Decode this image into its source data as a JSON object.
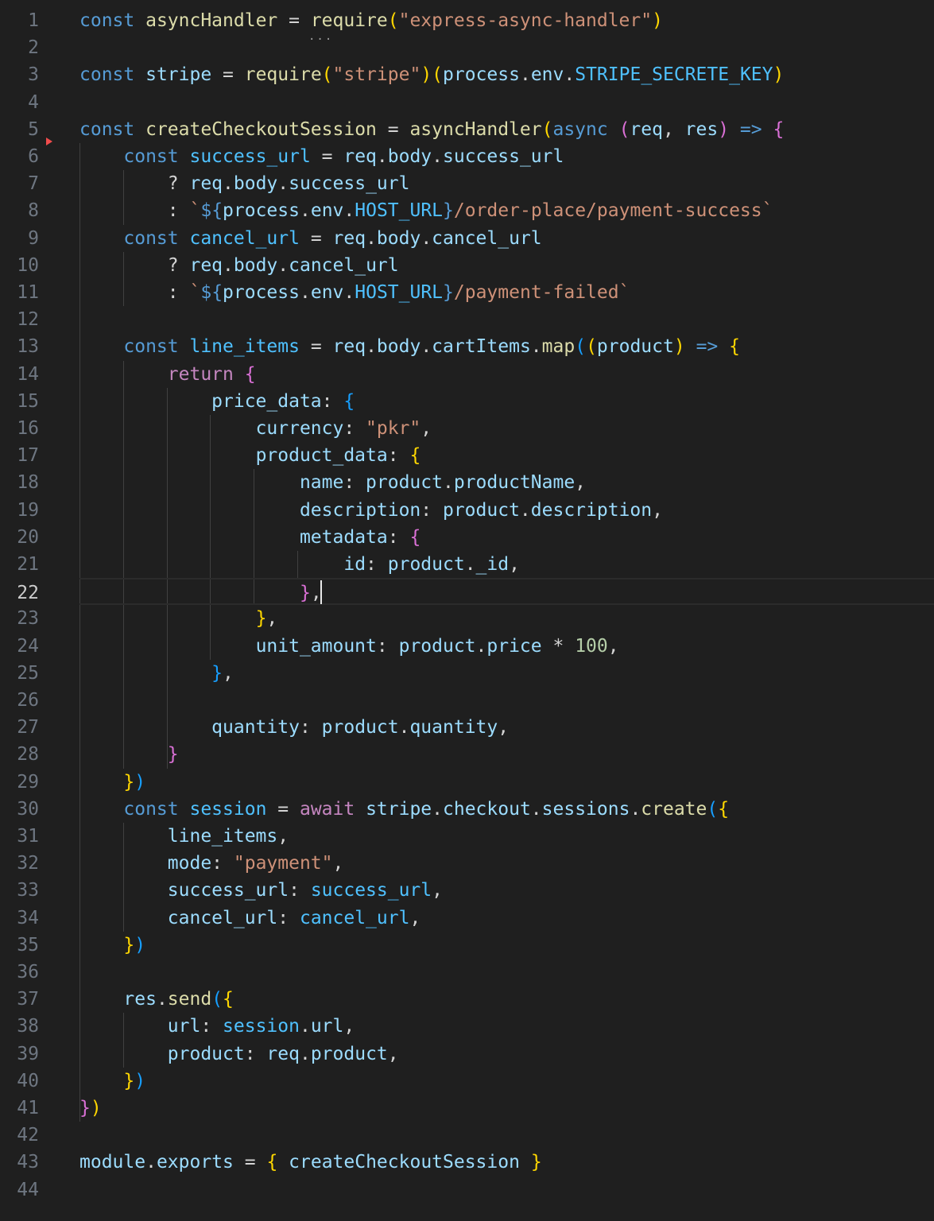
{
  "editor": {
    "active_line": 22,
    "lines": [
      {
        "n": "1",
        "t": [
          [
            "kw",
            "const "
          ],
          [
            "fn",
            "asyncHandler"
          ],
          [
            "op",
            " = "
          ],
          [
            "fn",
            "require"
          ],
          [
            "p1",
            "("
          ],
          [
            "str",
            "\"express-async-handler\""
          ],
          [
            "p1",
            ")"
          ]
        ]
      },
      {
        "n": "2",
        "t": []
      },
      {
        "n": "3",
        "t": [
          [
            "kw",
            "const "
          ],
          [
            "var",
            "stripe"
          ],
          [
            "op",
            " = "
          ],
          [
            "fn",
            "require"
          ],
          [
            "p1",
            "("
          ],
          [
            "str",
            "\"stripe\""
          ],
          [
            "p1",
            ")"
          ],
          [
            "p1",
            "("
          ],
          [
            "var",
            "process"
          ],
          [
            "op",
            "."
          ],
          [
            "var",
            "env"
          ],
          [
            "op",
            "."
          ],
          [
            "cst",
            "STRIPE_SECRETE_KEY"
          ],
          [
            "p1",
            ")"
          ]
        ]
      },
      {
        "n": "4",
        "t": []
      },
      {
        "n": "5",
        "t": [
          [
            "kw",
            "const "
          ],
          [
            "fn",
            "createCheckoutSession"
          ],
          [
            "op",
            " = "
          ],
          [
            "fn",
            "asyncHandler"
          ],
          [
            "p1",
            "("
          ],
          [
            "kw",
            "async "
          ],
          [
            "p2",
            "("
          ],
          [
            "var",
            "req"
          ],
          [
            "op",
            ", "
          ],
          [
            "var",
            "res"
          ],
          [
            "p2",
            ")"
          ],
          [
            "kw",
            " => "
          ],
          [
            "p2",
            "{"
          ]
        ]
      },
      {
        "n": "6",
        "t": [
          [
            "op",
            "    "
          ],
          [
            "kw",
            "const "
          ],
          [
            "cst",
            "success_url"
          ],
          [
            "op",
            " = "
          ],
          [
            "var",
            "req"
          ],
          [
            "op",
            "."
          ],
          [
            "var",
            "body"
          ],
          [
            "op",
            "."
          ],
          [
            "var",
            "success_url"
          ]
        ]
      },
      {
        "n": "7",
        "t": [
          [
            "op",
            "        ? "
          ],
          [
            "var",
            "req"
          ],
          [
            "op",
            "."
          ],
          [
            "var",
            "body"
          ],
          [
            "op",
            "."
          ],
          [
            "var",
            "success_url"
          ]
        ]
      },
      {
        "n": "8",
        "t": [
          [
            "op",
            "        : "
          ],
          [
            "str",
            "`"
          ],
          [
            "kw",
            "${"
          ],
          [
            "var",
            "process"
          ],
          [
            "op",
            "."
          ],
          [
            "var",
            "env"
          ],
          [
            "op",
            "."
          ],
          [
            "cst",
            "HOST_URL"
          ],
          [
            "kw",
            "}"
          ],
          [
            "str",
            "/order-place/payment-success`"
          ]
        ]
      },
      {
        "n": "9",
        "t": [
          [
            "op",
            "    "
          ],
          [
            "kw",
            "const "
          ],
          [
            "cst",
            "cancel_url"
          ],
          [
            "op",
            " = "
          ],
          [
            "var",
            "req"
          ],
          [
            "op",
            "."
          ],
          [
            "var",
            "body"
          ],
          [
            "op",
            "."
          ],
          [
            "var",
            "cancel_url"
          ]
        ]
      },
      {
        "n": "10",
        "t": [
          [
            "op",
            "        ? "
          ],
          [
            "var",
            "req"
          ],
          [
            "op",
            "."
          ],
          [
            "var",
            "body"
          ],
          [
            "op",
            "."
          ],
          [
            "var",
            "cancel_url"
          ]
        ]
      },
      {
        "n": "11",
        "t": [
          [
            "op",
            "        : "
          ],
          [
            "str",
            "`"
          ],
          [
            "kw",
            "${"
          ],
          [
            "var",
            "process"
          ],
          [
            "op",
            "."
          ],
          [
            "var",
            "env"
          ],
          [
            "op",
            "."
          ],
          [
            "cst",
            "HOST_URL"
          ],
          [
            "kw",
            "}"
          ],
          [
            "str",
            "/payment-failed`"
          ]
        ]
      },
      {
        "n": "12",
        "t": []
      },
      {
        "n": "13",
        "t": [
          [
            "op",
            "    "
          ],
          [
            "kw",
            "const "
          ],
          [
            "cst",
            "line_items"
          ],
          [
            "op",
            " = "
          ],
          [
            "var",
            "req"
          ],
          [
            "op",
            "."
          ],
          [
            "var",
            "body"
          ],
          [
            "op",
            "."
          ],
          [
            "var",
            "cartItems"
          ],
          [
            "op",
            "."
          ],
          [
            "fn",
            "map"
          ],
          [
            "p3",
            "("
          ],
          [
            "p1",
            "("
          ],
          [
            "var",
            "product"
          ],
          [
            "p1",
            ")"
          ],
          [
            "kw",
            " => "
          ],
          [
            "p1",
            "{"
          ]
        ]
      },
      {
        "n": "14",
        "t": [
          [
            "op",
            "        "
          ],
          [
            "ctl",
            "return "
          ],
          [
            "p2",
            "{"
          ]
        ]
      },
      {
        "n": "15",
        "t": [
          [
            "op",
            "            "
          ],
          [
            "var",
            "price_data"
          ],
          [
            "op",
            ": "
          ],
          [
            "p3",
            "{"
          ]
        ]
      },
      {
        "n": "16",
        "t": [
          [
            "op",
            "                "
          ],
          [
            "var",
            "currency"
          ],
          [
            "op",
            ": "
          ],
          [
            "str",
            "\"pkr\""
          ],
          [
            "op",
            ","
          ]
        ]
      },
      {
        "n": "17",
        "t": [
          [
            "op",
            "                "
          ],
          [
            "var",
            "product_data"
          ],
          [
            "op",
            ": "
          ],
          [
            "p1",
            "{"
          ]
        ]
      },
      {
        "n": "18",
        "t": [
          [
            "op",
            "                    "
          ],
          [
            "var",
            "name"
          ],
          [
            "op",
            ": "
          ],
          [
            "var",
            "product"
          ],
          [
            "op",
            "."
          ],
          [
            "var",
            "productName"
          ],
          [
            "op",
            ","
          ]
        ]
      },
      {
        "n": "19",
        "t": [
          [
            "op",
            "                    "
          ],
          [
            "var",
            "description"
          ],
          [
            "op",
            ": "
          ],
          [
            "var",
            "product"
          ],
          [
            "op",
            "."
          ],
          [
            "var",
            "description"
          ],
          [
            "op",
            ","
          ]
        ]
      },
      {
        "n": "20",
        "t": [
          [
            "op",
            "                    "
          ],
          [
            "var",
            "metadata"
          ],
          [
            "op",
            ": "
          ],
          [
            "p2",
            "{"
          ]
        ]
      },
      {
        "n": "21",
        "t": [
          [
            "op",
            "                        "
          ],
          [
            "var",
            "id"
          ],
          [
            "op",
            ": "
          ],
          [
            "var",
            "product"
          ],
          [
            "op",
            "."
          ],
          [
            "var",
            "_id"
          ],
          [
            "op",
            ","
          ]
        ]
      },
      {
        "n": "22",
        "t": [
          [
            "op",
            "                    "
          ],
          [
            "p2",
            "}"
          ],
          [
            "op",
            ","
          ]
        ]
      },
      {
        "n": "23",
        "t": [
          [
            "op",
            "                "
          ],
          [
            "p1",
            "}"
          ],
          [
            "op",
            ","
          ]
        ]
      },
      {
        "n": "24",
        "t": [
          [
            "op",
            "                "
          ],
          [
            "var",
            "unit_amount"
          ],
          [
            "op",
            ": "
          ],
          [
            "var",
            "product"
          ],
          [
            "op",
            "."
          ],
          [
            "var",
            "price"
          ],
          [
            "op",
            " * "
          ],
          [
            "num",
            "100"
          ],
          [
            "op",
            ","
          ]
        ]
      },
      {
        "n": "25",
        "t": [
          [
            "op",
            "            "
          ],
          [
            "p3",
            "}"
          ],
          [
            "op",
            ","
          ]
        ]
      },
      {
        "n": "26",
        "t": []
      },
      {
        "n": "27",
        "t": [
          [
            "op",
            "            "
          ],
          [
            "var",
            "quantity"
          ],
          [
            "op",
            ": "
          ],
          [
            "var",
            "product"
          ],
          [
            "op",
            "."
          ],
          [
            "var",
            "quantity"
          ],
          [
            "op",
            ","
          ]
        ]
      },
      {
        "n": "28",
        "t": [
          [
            "op",
            "        "
          ],
          [
            "p2",
            "}"
          ]
        ]
      },
      {
        "n": "29",
        "t": [
          [
            "op",
            "    "
          ],
          [
            "p1",
            "}"
          ],
          [
            "p3",
            ")"
          ]
        ]
      },
      {
        "n": "30",
        "t": [
          [
            "op",
            "    "
          ],
          [
            "kw",
            "const "
          ],
          [
            "cst",
            "session"
          ],
          [
            "op",
            " = "
          ],
          [
            "ctl",
            "await "
          ],
          [
            "var",
            "stripe"
          ],
          [
            "op",
            "."
          ],
          [
            "var",
            "checkout"
          ],
          [
            "op",
            "."
          ],
          [
            "var",
            "sessions"
          ],
          [
            "op",
            "."
          ],
          [
            "fn",
            "create"
          ],
          [
            "p3",
            "("
          ],
          [
            "p1",
            "{"
          ]
        ]
      },
      {
        "n": "31",
        "t": [
          [
            "op",
            "        "
          ],
          [
            "var",
            "line_items"
          ],
          [
            "op",
            ","
          ]
        ]
      },
      {
        "n": "32",
        "t": [
          [
            "op",
            "        "
          ],
          [
            "var",
            "mode"
          ],
          [
            "op",
            ": "
          ],
          [
            "str",
            "\"payment\""
          ],
          [
            "op",
            ","
          ]
        ]
      },
      {
        "n": "33",
        "t": [
          [
            "op",
            "        "
          ],
          [
            "var",
            "success_url"
          ],
          [
            "op",
            ": "
          ],
          [
            "cst",
            "success_url"
          ],
          [
            "op",
            ","
          ]
        ]
      },
      {
        "n": "34",
        "t": [
          [
            "op",
            "        "
          ],
          [
            "var",
            "cancel_url"
          ],
          [
            "op",
            ": "
          ],
          [
            "cst",
            "cancel_url"
          ],
          [
            "op",
            ","
          ]
        ]
      },
      {
        "n": "35",
        "t": [
          [
            "op",
            "    "
          ],
          [
            "p1",
            "}"
          ],
          [
            "p3",
            ")"
          ]
        ]
      },
      {
        "n": "36",
        "t": []
      },
      {
        "n": "37",
        "t": [
          [
            "op",
            "    "
          ],
          [
            "var",
            "res"
          ],
          [
            "op",
            "."
          ],
          [
            "fn",
            "send"
          ],
          [
            "p3",
            "("
          ],
          [
            "p1",
            "{"
          ]
        ]
      },
      {
        "n": "38",
        "t": [
          [
            "op",
            "        "
          ],
          [
            "var",
            "url"
          ],
          [
            "op",
            ": "
          ],
          [
            "cst",
            "session"
          ],
          [
            "op",
            "."
          ],
          [
            "var",
            "url"
          ],
          [
            "op",
            ","
          ]
        ]
      },
      {
        "n": "39",
        "t": [
          [
            "op",
            "        "
          ],
          [
            "var",
            "product"
          ],
          [
            "op",
            ": "
          ],
          [
            "var",
            "req"
          ],
          [
            "op",
            "."
          ],
          [
            "var",
            "product"
          ],
          [
            "op",
            ","
          ]
        ]
      },
      {
        "n": "40",
        "t": [
          [
            "op",
            "    "
          ],
          [
            "p1",
            "}"
          ],
          [
            "p3",
            ")"
          ]
        ]
      },
      {
        "n": "41",
        "t": [
          [
            "p2",
            "}"
          ],
          [
            "p1",
            ")"
          ]
        ]
      },
      {
        "n": "42",
        "t": []
      },
      {
        "n": "43",
        "t": [
          [
            "var",
            "module"
          ],
          [
            "op",
            "."
          ],
          [
            "var",
            "exports"
          ],
          [
            "op",
            " = "
          ],
          [
            "p1",
            "{"
          ],
          [
            "op",
            " "
          ],
          [
            "var",
            "createCheckoutSession"
          ],
          [
            "op",
            " "
          ],
          [
            "p1",
            "}"
          ]
        ]
      },
      {
        "n": "44",
        "t": []
      }
    ]
  }
}
